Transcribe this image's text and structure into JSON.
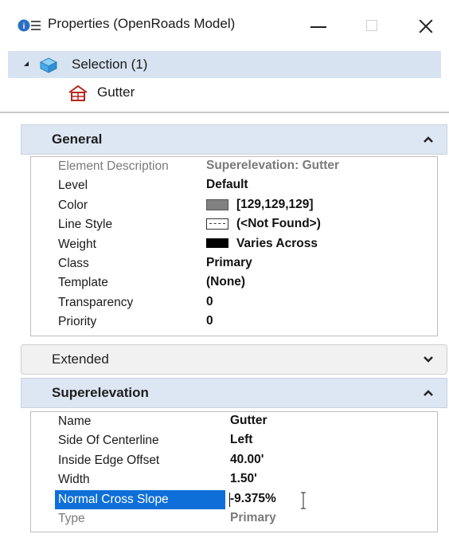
{
  "window": {
    "title": "Properties (OpenRoads Model)"
  },
  "tree": {
    "selection_label": "Selection (1)",
    "child_label": "Gutter"
  },
  "sections": {
    "general": {
      "title": "General",
      "rows": [
        {
          "name": "Element Description",
          "value": "Superelevation: Gutter",
          "dim": true
        },
        {
          "name": "Level",
          "value": "Default"
        },
        {
          "name": "Color",
          "value": "[129,129,129]",
          "swatch": "color",
          "swatch_color": "#818181"
        },
        {
          "name": "Line Style",
          "value": "(<Not Found>)",
          "swatch": "line"
        },
        {
          "name": "Weight",
          "value": "Varies Across",
          "swatch": "weight"
        },
        {
          "name": "Class",
          "value": "Primary"
        },
        {
          "name": "Template",
          "value": "(None)"
        },
        {
          "name": "Transparency",
          "value": "0"
        },
        {
          "name": "Priority",
          "value": "0"
        }
      ]
    },
    "extended": {
      "title": "Extended"
    },
    "superelevation": {
      "title": "Superelevation",
      "rows": [
        {
          "name": "Name",
          "value": "Gutter"
        },
        {
          "name": "Side Of Centerline",
          "value": "Left"
        },
        {
          "name": "Inside Edge Offset",
          "value": "40.00'"
        },
        {
          "name": "Width",
          "value": "1.50'"
        },
        {
          "name": "Normal Cross Slope",
          "value": "-9.375%",
          "editing": true
        },
        {
          "name": "Type",
          "value": "Primary",
          "dim": true
        }
      ]
    }
  },
  "colors": {
    "accent": "#0f6fd8",
    "header_bg": "#dde6f3",
    "tree_selected_bg": "#d7e3f1"
  }
}
